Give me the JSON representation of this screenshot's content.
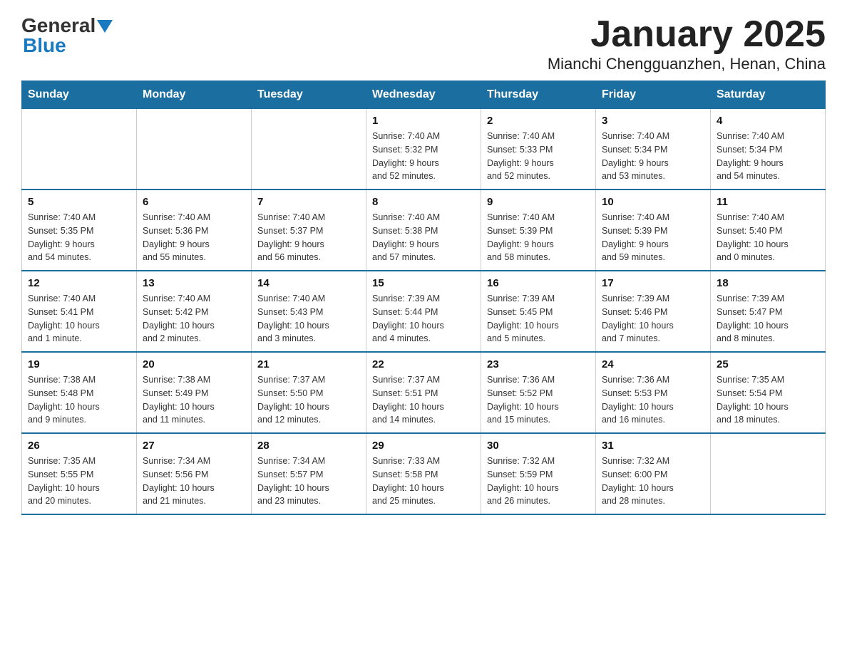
{
  "logo": {
    "text_general": "General",
    "text_blue": "Blue"
  },
  "title": "January 2025",
  "subtitle": "Mianchi Chengguanzhen, Henan, China",
  "days_of_week": [
    "Sunday",
    "Monday",
    "Tuesday",
    "Wednesday",
    "Thursday",
    "Friday",
    "Saturday"
  ],
  "weeks": [
    [
      {
        "day": "",
        "info": ""
      },
      {
        "day": "",
        "info": ""
      },
      {
        "day": "",
        "info": ""
      },
      {
        "day": "1",
        "info": "Sunrise: 7:40 AM\nSunset: 5:32 PM\nDaylight: 9 hours\nand 52 minutes."
      },
      {
        "day": "2",
        "info": "Sunrise: 7:40 AM\nSunset: 5:33 PM\nDaylight: 9 hours\nand 52 minutes."
      },
      {
        "day": "3",
        "info": "Sunrise: 7:40 AM\nSunset: 5:34 PM\nDaylight: 9 hours\nand 53 minutes."
      },
      {
        "day": "4",
        "info": "Sunrise: 7:40 AM\nSunset: 5:34 PM\nDaylight: 9 hours\nand 54 minutes."
      }
    ],
    [
      {
        "day": "5",
        "info": "Sunrise: 7:40 AM\nSunset: 5:35 PM\nDaylight: 9 hours\nand 54 minutes."
      },
      {
        "day": "6",
        "info": "Sunrise: 7:40 AM\nSunset: 5:36 PM\nDaylight: 9 hours\nand 55 minutes."
      },
      {
        "day": "7",
        "info": "Sunrise: 7:40 AM\nSunset: 5:37 PM\nDaylight: 9 hours\nand 56 minutes."
      },
      {
        "day": "8",
        "info": "Sunrise: 7:40 AM\nSunset: 5:38 PM\nDaylight: 9 hours\nand 57 minutes."
      },
      {
        "day": "9",
        "info": "Sunrise: 7:40 AM\nSunset: 5:39 PM\nDaylight: 9 hours\nand 58 minutes."
      },
      {
        "day": "10",
        "info": "Sunrise: 7:40 AM\nSunset: 5:39 PM\nDaylight: 9 hours\nand 59 minutes."
      },
      {
        "day": "11",
        "info": "Sunrise: 7:40 AM\nSunset: 5:40 PM\nDaylight: 10 hours\nand 0 minutes."
      }
    ],
    [
      {
        "day": "12",
        "info": "Sunrise: 7:40 AM\nSunset: 5:41 PM\nDaylight: 10 hours\nand 1 minute."
      },
      {
        "day": "13",
        "info": "Sunrise: 7:40 AM\nSunset: 5:42 PM\nDaylight: 10 hours\nand 2 minutes."
      },
      {
        "day": "14",
        "info": "Sunrise: 7:40 AM\nSunset: 5:43 PM\nDaylight: 10 hours\nand 3 minutes."
      },
      {
        "day": "15",
        "info": "Sunrise: 7:39 AM\nSunset: 5:44 PM\nDaylight: 10 hours\nand 4 minutes."
      },
      {
        "day": "16",
        "info": "Sunrise: 7:39 AM\nSunset: 5:45 PM\nDaylight: 10 hours\nand 5 minutes."
      },
      {
        "day": "17",
        "info": "Sunrise: 7:39 AM\nSunset: 5:46 PM\nDaylight: 10 hours\nand 7 minutes."
      },
      {
        "day": "18",
        "info": "Sunrise: 7:39 AM\nSunset: 5:47 PM\nDaylight: 10 hours\nand 8 minutes."
      }
    ],
    [
      {
        "day": "19",
        "info": "Sunrise: 7:38 AM\nSunset: 5:48 PM\nDaylight: 10 hours\nand 9 minutes."
      },
      {
        "day": "20",
        "info": "Sunrise: 7:38 AM\nSunset: 5:49 PM\nDaylight: 10 hours\nand 11 minutes."
      },
      {
        "day": "21",
        "info": "Sunrise: 7:37 AM\nSunset: 5:50 PM\nDaylight: 10 hours\nand 12 minutes."
      },
      {
        "day": "22",
        "info": "Sunrise: 7:37 AM\nSunset: 5:51 PM\nDaylight: 10 hours\nand 14 minutes."
      },
      {
        "day": "23",
        "info": "Sunrise: 7:36 AM\nSunset: 5:52 PM\nDaylight: 10 hours\nand 15 minutes."
      },
      {
        "day": "24",
        "info": "Sunrise: 7:36 AM\nSunset: 5:53 PM\nDaylight: 10 hours\nand 16 minutes."
      },
      {
        "day": "25",
        "info": "Sunrise: 7:35 AM\nSunset: 5:54 PM\nDaylight: 10 hours\nand 18 minutes."
      }
    ],
    [
      {
        "day": "26",
        "info": "Sunrise: 7:35 AM\nSunset: 5:55 PM\nDaylight: 10 hours\nand 20 minutes."
      },
      {
        "day": "27",
        "info": "Sunrise: 7:34 AM\nSunset: 5:56 PM\nDaylight: 10 hours\nand 21 minutes."
      },
      {
        "day": "28",
        "info": "Sunrise: 7:34 AM\nSunset: 5:57 PM\nDaylight: 10 hours\nand 23 minutes."
      },
      {
        "day": "29",
        "info": "Sunrise: 7:33 AM\nSunset: 5:58 PM\nDaylight: 10 hours\nand 25 minutes."
      },
      {
        "day": "30",
        "info": "Sunrise: 7:32 AM\nSunset: 5:59 PM\nDaylight: 10 hours\nand 26 minutes."
      },
      {
        "day": "31",
        "info": "Sunrise: 7:32 AM\nSunset: 6:00 PM\nDaylight: 10 hours\nand 28 minutes."
      },
      {
        "day": "",
        "info": ""
      }
    ]
  ]
}
